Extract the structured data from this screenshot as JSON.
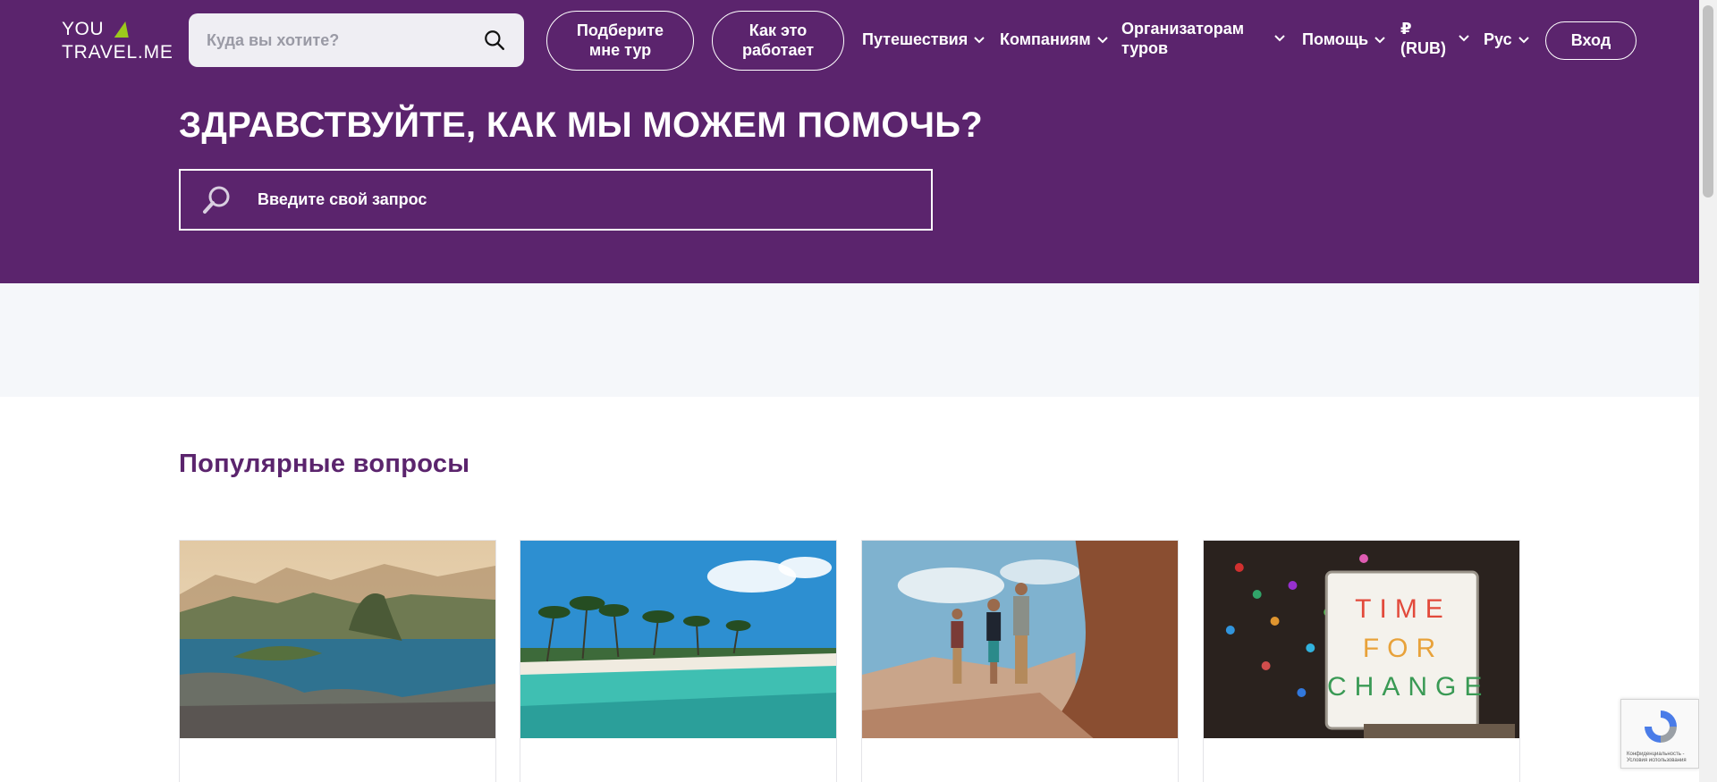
{
  "header": {
    "logo_line1": "YOU",
    "logo_line2": "TRAVEL.ME",
    "search_placeholder": "Куда вы хотите?",
    "pick_tour_label": "Подберите мне тур",
    "how_it_works_label": "Как это работает",
    "nav": {
      "travel": "Путешествия",
      "companies": "Компаниям",
      "organizers": "Организаторам туров",
      "help": "Помощь",
      "currency": "₽ (RUB)",
      "language": "Рус"
    },
    "login_label": "Вход"
  },
  "hero": {
    "title": "ЗДРАВСТВУЙТЕ, КАК МЫ МОЖЕМ ПОМОЧЬ?",
    "search_placeholder": "Введите свой запрос"
  },
  "popular": {
    "title": "Популярные вопросы",
    "cards": [
      {
        "image": "rio-bay-photo"
      },
      {
        "image": "tropical-beach-photo"
      },
      {
        "image": "desert-travelers-photo"
      },
      {
        "image": "time-for-change-lightbox-photo",
        "lightbox_text": [
          "TIME",
          "FOR",
          "CHANGE"
        ]
      }
    ]
  },
  "recaptcha": {
    "text": "Конфиденциальность - Условия использования"
  },
  "colors": {
    "brand_purple": "#5b246d",
    "logo_green": "#9cc91c",
    "band_bg": "#f5f7fa"
  }
}
